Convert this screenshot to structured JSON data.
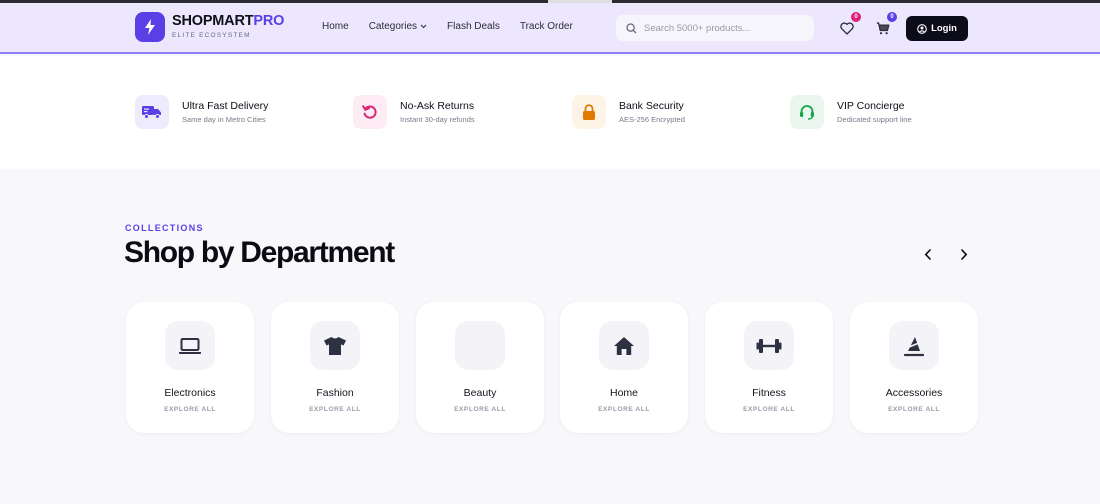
{
  "header": {
    "brand_primary": "SHOPMART",
    "brand_accent": "PRO",
    "tagline": "ELITE ECOSYSTEM",
    "nav": [
      {
        "label": "Home"
      },
      {
        "label": "Categories"
      },
      {
        "label": "Flash Deals"
      },
      {
        "label": "Track Order"
      }
    ],
    "search_placeholder": "Search 5000+ products...",
    "wishlist_count": "0",
    "cart_count": "0",
    "login_label": "Login"
  },
  "features": [
    {
      "title": "Ultra Fast Delivery",
      "subtitle": "Same day in Metro Cities",
      "icon": "truck-icon",
      "color": "#5b3fe6"
    },
    {
      "title": "No-Ask Returns",
      "subtitle": "Instant 30-day refunds",
      "icon": "return-icon",
      "color": "#db2777"
    },
    {
      "title": "Bank Security",
      "subtitle": "AES-256 Encrypted",
      "icon": "lock-icon",
      "color": "#e07b00"
    },
    {
      "title": "VIP Concierge",
      "subtitle": "Dedicated support line",
      "icon": "headset-icon",
      "color": "#16a34a"
    }
  ],
  "collections": {
    "eyebrow": "COLLECTIONS",
    "title": "Shop by Department",
    "categories": [
      {
        "name": "Electronics",
        "explore": "EXPLORE ALL",
        "icon": "laptop-icon"
      },
      {
        "name": "Fashion",
        "explore": "EXPLORE ALL",
        "icon": "tshirt-icon"
      },
      {
        "name": "Beauty",
        "explore": "EXPLORE ALL",
        "icon": "blank-icon"
      },
      {
        "name": "Home",
        "explore": "EXPLORE ALL",
        "icon": "house-icon"
      },
      {
        "name": "Fitness",
        "explore": "EXPLORE ALL",
        "icon": "dumbbell-icon"
      },
      {
        "name": "Accessories",
        "explore": "EXPLORE ALL",
        "icon": "accessory-icon"
      }
    ]
  },
  "colors": {
    "accent": "#5b3fe6",
    "header_bg": "#ece7fd",
    "dark": "#0b0b1a"
  }
}
